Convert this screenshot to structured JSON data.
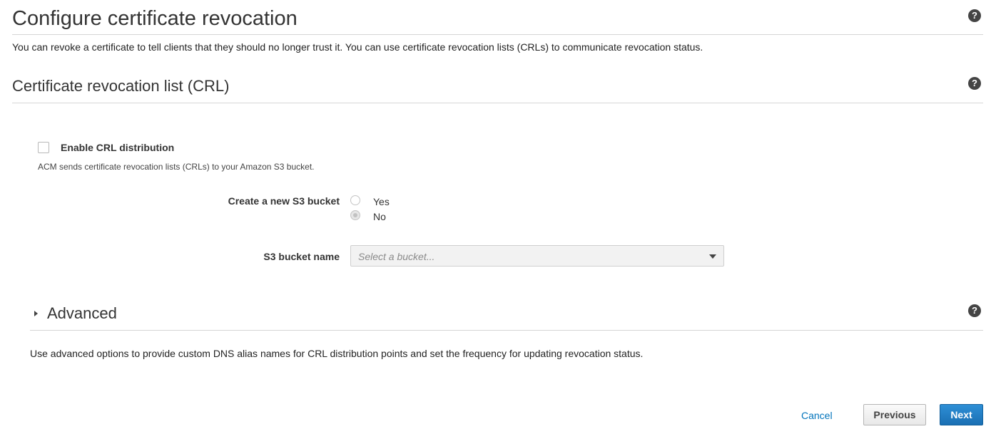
{
  "page": {
    "title": "Configure certificate revocation",
    "description": "You can revoke a certificate to tell clients that they should no longer trust it. You can use certificate revocation lists (CRLs) to communicate revocation status."
  },
  "help_icon": "?",
  "crl_section": {
    "title": "Certificate revocation list (CRL)",
    "enable_label": "Enable CRL distribution",
    "enable_checked": false,
    "enable_help": "ACM sends certificate revocation lists (CRLs) to your Amazon S3 bucket.",
    "create_bucket_label": "Create a new S3 bucket",
    "create_bucket_options": [
      "Yes",
      "No"
    ],
    "create_bucket_selected": "No",
    "bucket_name_label": "S3 bucket name",
    "bucket_name_placeholder": "Select a bucket..."
  },
  "advanced": {
    "title": "Advanced",
    "description": "Use advanced options to provide custom DNS alias names for CRL distribution points and set the frequency for updating revocation status."
  },
  "footer": {
    "cancel_label": "Cancel",
    "previous_label": "Previous",
    "next_label": "Next"
  },
  "colors": {
    "primary_button": "#1a6fb3",
    "link": "#0073bb"
  }
}
